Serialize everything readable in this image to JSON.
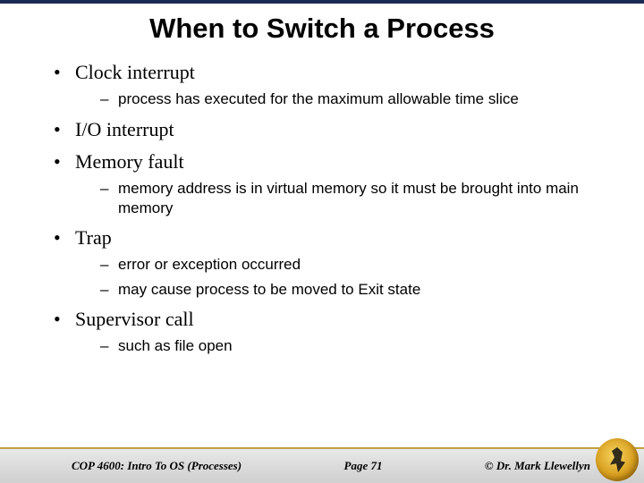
{
  "title": "When to Switch a Process",
  "bullets": [
    {
      "text": "Clock interrupt",
      "sub": [
        "process has executed for the maximum allowable time slice"
      ]
    },
    {
      "text": "I/O interrupt",
      "sub": []
    },
    {
      "text": "Memory fault",
      "sub": [
        "memory address is in virtual memory so it must be brought into main memory"
      ]
    },
    {
      "text": "Trap",
      "sub": [
        "error or exception occurred",
        "may cause process to be moved to Exit state"
      ]
    },
    {
      "text": "Supervisor call",
      "sub": [
        "such as file open"
      ]
    }
  ],
  "footer": {
    "course": "COP 4600: Intro To OS  (Processes)",
    "page": "Page 71",
    "copyright": "© Dr. Mark Llewellyn"
  }
}
